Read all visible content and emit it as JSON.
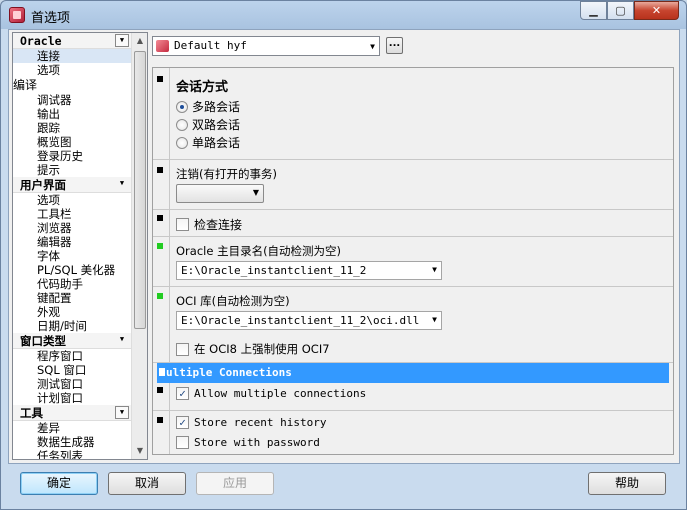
{
  "window": {
    "title": "首选项",
    "minimize_glyph": "▁",
    "maximize_glyph": "▢",
    "close_glyph": "✕"
  },
  "nav": {
    "groups": [
      {
        "label": "Oracle",
        "items": [
          "连接",
          "选项"
        ]
      },
      {
        "label": "编译",
        "items": [
          "调试器",
          "输出",
          "跟踪",
          "概览图",
          "登录历史",
          "提示"
        ]
      },
      {
        "label": "用户界面",
        "items": [
          "选项",
          "工具栏",
          "浏览器",
          "编辑器",
          "字体",
          "PL/SQL 美化器",
          "代码助手",
          "键配置",
          "外观",
          "日期/时间"
        ]
      },
      {
        "label": "窗口类型",
        "items": [
          "程序窗口",
          "SQL 窗口",
          "测试窗口",
          "计划窗口"
        ]
      },
      {
        "label": "工具",
        "items": [
          "差异",
          "数据生成器",
          "任务列表"
        ]
      }
    ],
    "selected": "连接"
  },
  "profile": {
    "value": "Default hyf",
    "more_label": "..."
  },
  "session": {
    "title": "会话方式",
    "options": [
      "多路会话",
      "双路会话",
      "单路会话"
    ],
    "selected": "多路会话"
  },
  "logoff": {
    "label": "注销(有打开的事务)",
    "value": ""
  },
  "check_connection": {
    "label": "检查连接",
    "checked": false
  },
  "oracle_home": {
    "label": "Oracle 主目录名(自动检测为空)",
    "value": "E:\\Oracle_instantclient_11_2"
  },
  "oci_library": {
    "label": "OCI 库(自动检测为空)",
    "value": "E:\\Oracle_instantclient_11_2\\oci.dll"
  },
  "force_oci7": {
    "label": "在 OCI8 上强制使用 OCI7",
    "checked": false
  },
  "multiple_connections": {
    "title": "ultiple Connections",
    "allow_label": "Allow multiple connections",
    "allow_checked": true
  },
  "history": {
    "store_recent_label": "Store recent history",
    "store_recent_checked": true,
    "store_password_label": "Store with password",
    "store_password_checked": false
  },
  "footer": {
    "ok": "确定",
    "cancel": "取消",
    "apply": "应用",
    "help": "帮助"
  },
  "colors": {
    "selection_band": "#3399ff",
    "marker_green": "#22cc22",
    "nav_selected": "#d9e6f5"
  }
}
